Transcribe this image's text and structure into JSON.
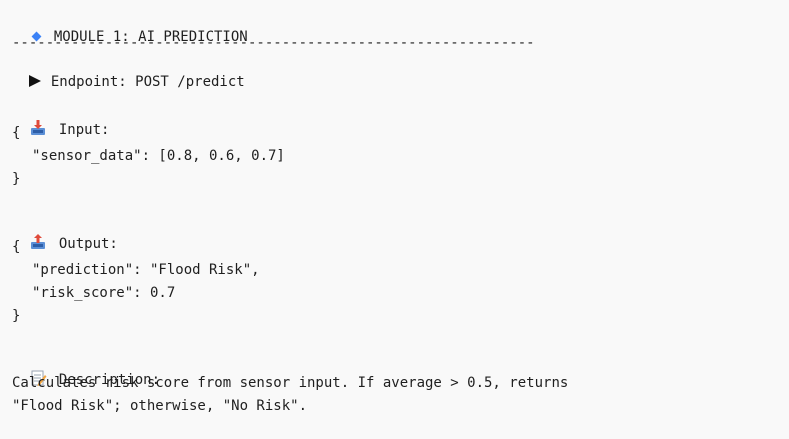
{
  "module_header": "MODULE 1: AI PREDICTION",
  "separator": "--------------------------------------------------------------",
  "endpoint_line": "Endpoint: POST /predict",
  "input": {
    "label": "Input:",
    "open_brace": "{",
    "lines": [
      "\"sensor_data\": [0.8, 0.6, 0.7]"
    ],
    "close_brace": "}"
  },
  "output": {
    "label": "Output:",
    "open_brace": "{",
    "lines": [
      "\"prediction\": \"Flood Risk\",",
      "\"risk_score\": 0.7"
    ],
    "close_brace": "}"
  },
  "description": {
    "label": "Description:",
    "lines": [
      "Calculates risk score from sensor input. If average > 0.5, returns",
      "\"Flood Risk\"; otherwise, \"No Risk\"."
    ]
  },
  "icons": {
    "module": "blue-diamond-icon",
    "endpoint": "play-triangle-icon",
    "input": "inbox-tray-icon",
    "output": "outbox-tray-icon",
    "description": "memo-icon"
  },
  "colors": {
    "background": "#f9f9f9",
    "text": "#1f1f1f",
    "accent_blue": "#3b82f6"
  }
}
